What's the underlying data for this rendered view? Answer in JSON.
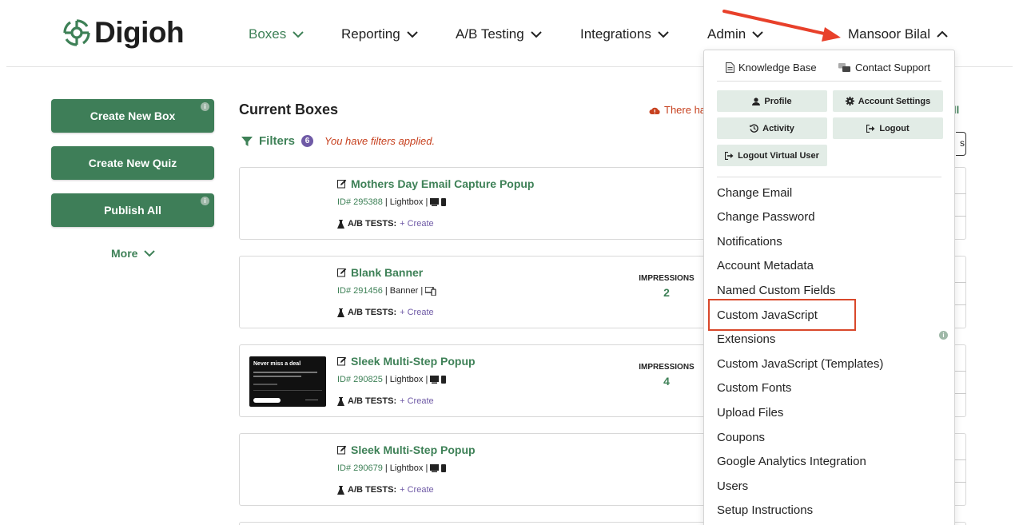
{
  "brand": {
    "name": "Digioh",
    "accent": "#3e8157",
    "button_color": "#3e7e58"
  },
  "nav": {
    "items": [
      {
        "label": "Boxes",
        "active": true
      },
      {
        "label": "Reporting",
        "active": false
      },
      {
        "label": "A/B Testing",
        "active": false
      },
      {
        "label": "Integrations",
        "active": false
      },
      {
        "label": "Admin",
        "active": false
      }
    ],
    "user": "Mansoor Bilal"
  },
  "sidebar": {
    "create_box": "Create New Box",
    "create_quiz": "Create New Quiz",
    "publish_all": "Publish All",
    "more": "More",
    "info_glyph": "i"
  },
  "main": {
    "title": "Current Boxes",
    "filters_label": "Filters",
    "filter_count": "6",
    "filter_note": "You have filters applied.",
    "warning_text": "There ha",
    "all_link": "ll",
    "edge_text": "s"
  },
  "boxes": [
    {
      "title": "Mothers Day Email Capture Popup",
      "id": "ID# 295388",
      "type": "| Lightbox |",
      "ab_label": "A/B TESTS:",
      "ab_create": "+ Create",
      "impressions_label": "",
      "impressions": ""
    },
    {
      "title": "Blank Banner",
      "id": "ID# 291456",
      "type": "| Banner |",
      "ab_label": "A/B TESTS:",
      "ab_create": "+ Create",
      "impressions_label": "IMPRESSIONS",
      "impressions": "2"
    },
    {
      "title": "Sleek Multi-Step Popup",
      "id": "ID# 290825",
      "type": "| Lightbox |",
      "ab_label": "A/B TESTS:",
      "ab_create": "+ Create",
      "impressions_label": "IMPRESSIONS",
      "impressions": "4",
      "thumb_title": "Never miss a deal"
    },
    {
      "title": "Sleek Multi-Step Popup",
      "id": "ID# 290679",
      "type": "| Lightbox |",
      "ab_label": "A/B TESTS:",
      "ab_create": "+ Create",
      "impressions_label": "",
      "impressions": ""
    }
  ],
  "dropdown": {
    "knowledge_base": "Knowledge Base",
    "contact_support": "Contact Support",
    "profile": "Profile",
    "account_settings": "Account Settings",
    "activity": "Activity",
    "logout": "Logout",
    "logout_virtual": "Logout Virtual User",
    "items": [
      "Change Email",
      "Change Password",
      "Notifications",
      "Account Metadata",
      "Named Custom Fields",
      "Custom JavaScript",
      "Extensions",
      "Custom JavaScript (Templates)",
      "Custom Fonts",
      "Upload Files",
      "Coupons",
      "Google Analytics Integration",
      "Users",
      "Setup Instructions"
    ],
    "highlighted_item": "Custom JavaScript",
    "highlight_color": "#d9482b"
  }
}
